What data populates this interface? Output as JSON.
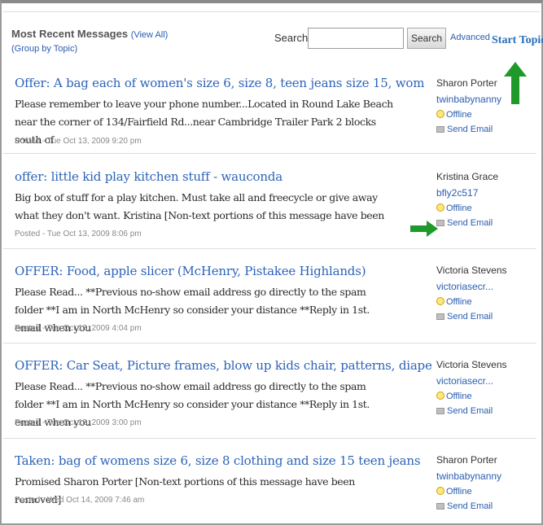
{
  "header": {
    "title": "Most Recent Messages",
    "view_all": "(View All)",
    "group_by_topic": "(Group by Topic)",
    "search_label": "Search:",
    "search_value": "",
    "search_button": "Search",
    "advanced": "Advanced",
    "start_topic": "Start Topic"
  },
  "messages": [
    {
      "subject": "Offer: A bag each of women's size 6, size 8, teen jeans size 15, wom",
      "snippet": "Please remember to leave your phone number...Located in Round Lake Beach near the corner of 134/Fairfield Rd...near Cambridge Trailer Park 2 blocks south of",
      "posted": "Posted - Tue Oct 13, 2009 9:20 pm",
      "author_name": "Sharon Porter",
      "author_id": "twinbabynanny",
      "status": "Offline",
      "send_email": "Send Email"
    },
    {
      "subject": "offer: little kid play kitchen stuff - wauconda",
      "snippet": "Big box of stuff for a play kitchen. Must take all and freecycle or give away what they don't want. Kristina [Non-text portions of this message have been",
      "posted": "Posted - Tue Oct 13, 2009 8:06 pm",
      "author_name": "Kristina Grace",
      "author_id": "bfly2c517",
      "status": "Offline",
      "send_email": "Send Email"
    },
    {
      "subject": "OFFER: Food, apple slicer (McHenry, Pistakee Highlands)",
      "snippet": "Please Read... **Previous no-show email address go directly to the spam folder **I am in North McHenry so consider your distance **Reply in 1st. email when you",
      "posted": "Posted - Tue Oct 13, 2009 4:04 pm",
      "author_name": "Victoria Stevens",
      "author_id": "victoriasecr...",
      "status": "Offline",
      "send_email": "Send Email"
    },
    {
      "subject": "OFFER: Car Seat, Picture frames, blow up kids chair, patterns, diape",
      "snippet": "Please Read... **Previous no-show email address go directly to the spam folder **I am in North McHenry so consider your distance **Reply in 1st. email when you",
      "posted": "Posted - Tue Oct 13, 2009 3:00 pm",
      "author_name": "Victoria Stevens",
      "author_id": "victoriasecr...",
      "status": "Offline",
      "send_email": "Send Email"
    },
    {
      "subject": "Taken: bag of womens size 6, size 8 clothing and size 15 teen jeans",
      "snippet": "Promised Sharon Porter [Non-text portions of this message have been removed]",
      "posted": "Posted - Wed Oct 14, 2009 7:46 am",
      "author_name": "Sharon Porter",
      "author_id": "twinbabynanny",
      "status": "Offline",
      "send_email": "Send Email"
    }
  ],
  "colors": {
    "link": "#2d63b8",
    "arrow": "#1f9a2a"
  },
  "icons": [
    "arrow-up-icon",
    "arrow-right-icon",
    "smiley-icon",
    "mail-icon"
  ]
}
